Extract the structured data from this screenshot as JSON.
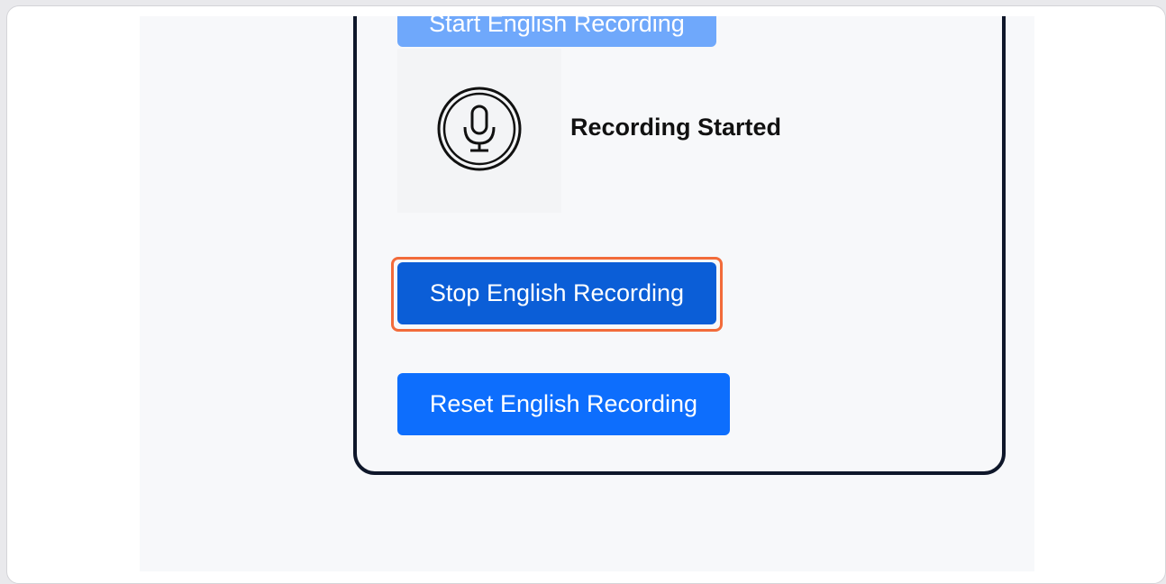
{
  "card": {
    "start_button_label": "Start English Recording",
    "status_text": "Recording Started",
    "stop_button_label": "Stop English Recording",
    "reset_button_label": "Reset English Recording"
  },
  "icons": {
    "status_icon": "microphone-icon"
  },
  "colors": {
    "start_button": "#6fa8fb",
    "stop_button": "#0b5ed7",
    "reset_button": "#0d6efd",
    "highlight_outline": "#f26b3a",
    "card_border": "#0f172a"
  }
}
